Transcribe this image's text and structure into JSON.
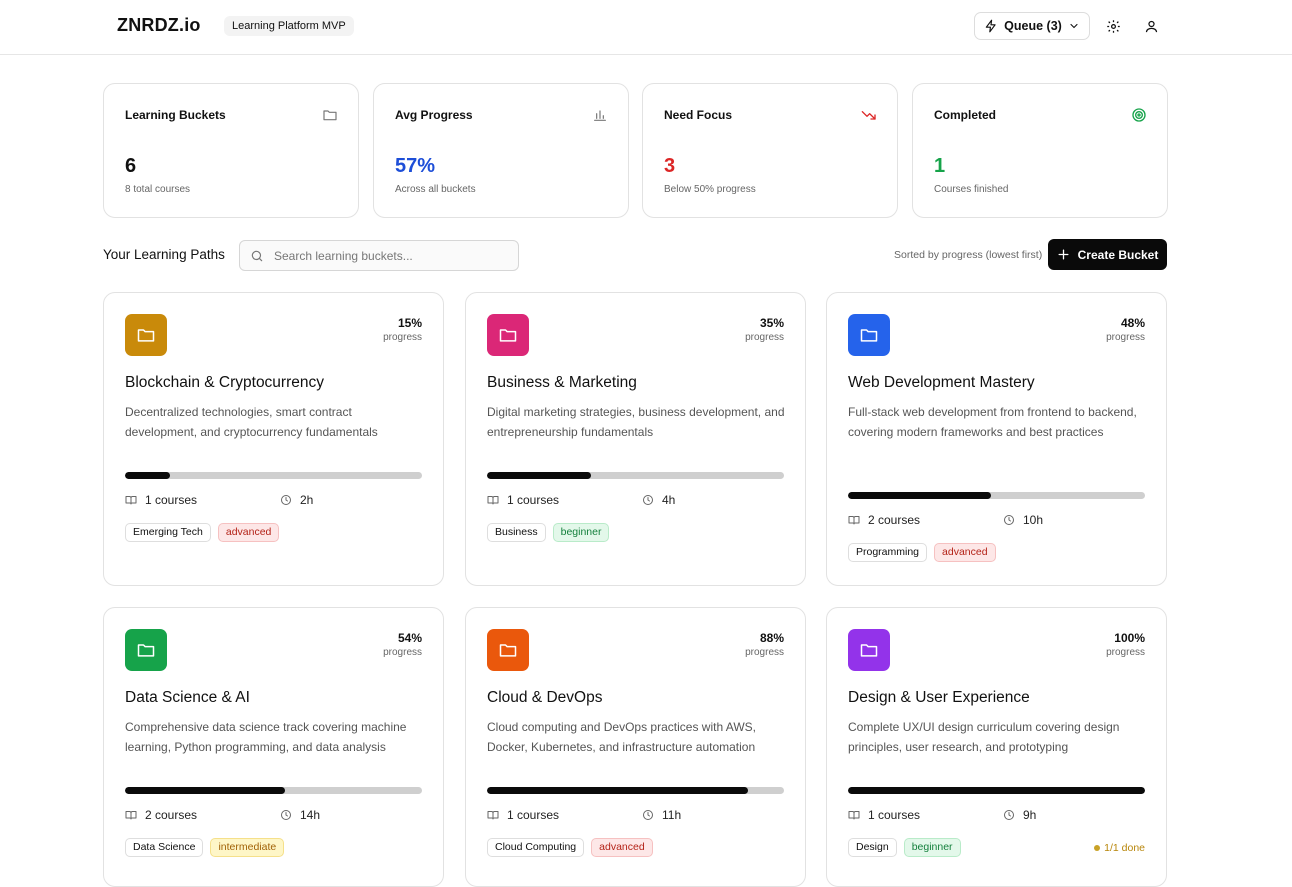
{
  "header": {
    "logo": "ZNRDZ.io",
    "badge": "Learning Platform MVP",
    "queue_label": "Queue (3)"
  },
  "stats": [
    {
      "label": "Learning Buckets",
      "value": "6",
      "sub": "8 total courses",
      "icon": "folder-icon",
      "color": "#111111"
    },
    {
      "label": "Avg Progress",
      "value": "57%",
      "sub": "Across all buckets",
      "icon": "bar-chart-icon",
      "color": "#1d4ed8"
    },
    {
      "label": "Need Focus",
      "value": "3",
      "sub": "Below 50% progress",
      "icon": "trending-down-icon",
      "color": "#dc2626"
    },
    {
      "label": "Completed",
      "value": "1",
      "sub": "Courses finished",
      "icon": "target-icon",
      "color": "#16a34a"
    }
  ],
  "toolbar": {
    "title": "Your Learning Paths",
    "search_placeholder": "Search learning buckets...",
    "sorted_text": "Sorted by progress (lowest first)",
    "create_label": "Create Bucket"
  },
  "buckets": [
    {
      "title": "Blockchain & Cryptocurrency",
      "description": "Decentralized technologies, smart contract development, and cryptocurrency fundamentals",
      "progress": 15,
      "progress_label": "15%",
      "progress_sub": "progress",
      "courses": "1 courses",
      "hours": "2h",
      "category": "Emerging Tech",
      "level": "advanced",
      "color": "#c98a0a"
    },
    {
      "title": "Business & Marketing",
      "description": "Digital marketing strategies, business development, and entrepreneurship fundamentals",
      "progress": 35,
      "progress_label": "35%",
      "progress_sub": "progress",
      "courses": "1 courses",
      "hours": "4h",
      "category": "Business",
      "level": "beginner",
      "color": "#db2777"
    },
    {
      "title": "Web Development Mastery",
      "description": "Full-stack web development from frontend to backend, covering modern frameworks and best practices",
      "progress": 48,
      "progress_label": "48%",
      "progress_sub": "progress",
      "courses": "2 courses",
      "hours": "10h",
      "category": "Programming",
      "level": "advanced",
      "color": "#2563eb"
    },
    {
      "title": "Data Science & AI",
      "description": "Comprehensive data science track covering machine learning, Python programming, and data analysis",
      "progress": 54,
      "progress_label": "54%",
      "progress_sub": "progress",
      "courses": "2 courses",
      "hours": "14h",
      "category": "Data Science",
      "level": "intermediate",
      "color": "#16a34a"
    },
    {
      "title": "Cloud & DevOps",
      "description": "Cloud computing and DevOps practices with AWS, Docker, Kubernetes, and infrastructure automation",
      "progress": 88,
      "progress_label": "88%",
      "progress_sub": "progress",
      "courses": "1 courses",
      "hours": "11h",
      "category": "Cloud Computing",
      "level": "advanced",
      "color": "#ea580c"
    },
    {
      "title": "Design & User Experience",
      "description": "Complete UX/UI design curriculum covering design principles, user research, and prototyping",
      "progress": 100,
      "progress_label": "100%",
      "progress_sub": "progress",
      "courses": "1 courses",
      "hours": "9h",
      "category": "Design",
      "level": "beginner",
      "done_label": "1/1 done",
      "color": "#9333ea"
    }
  ]
}
